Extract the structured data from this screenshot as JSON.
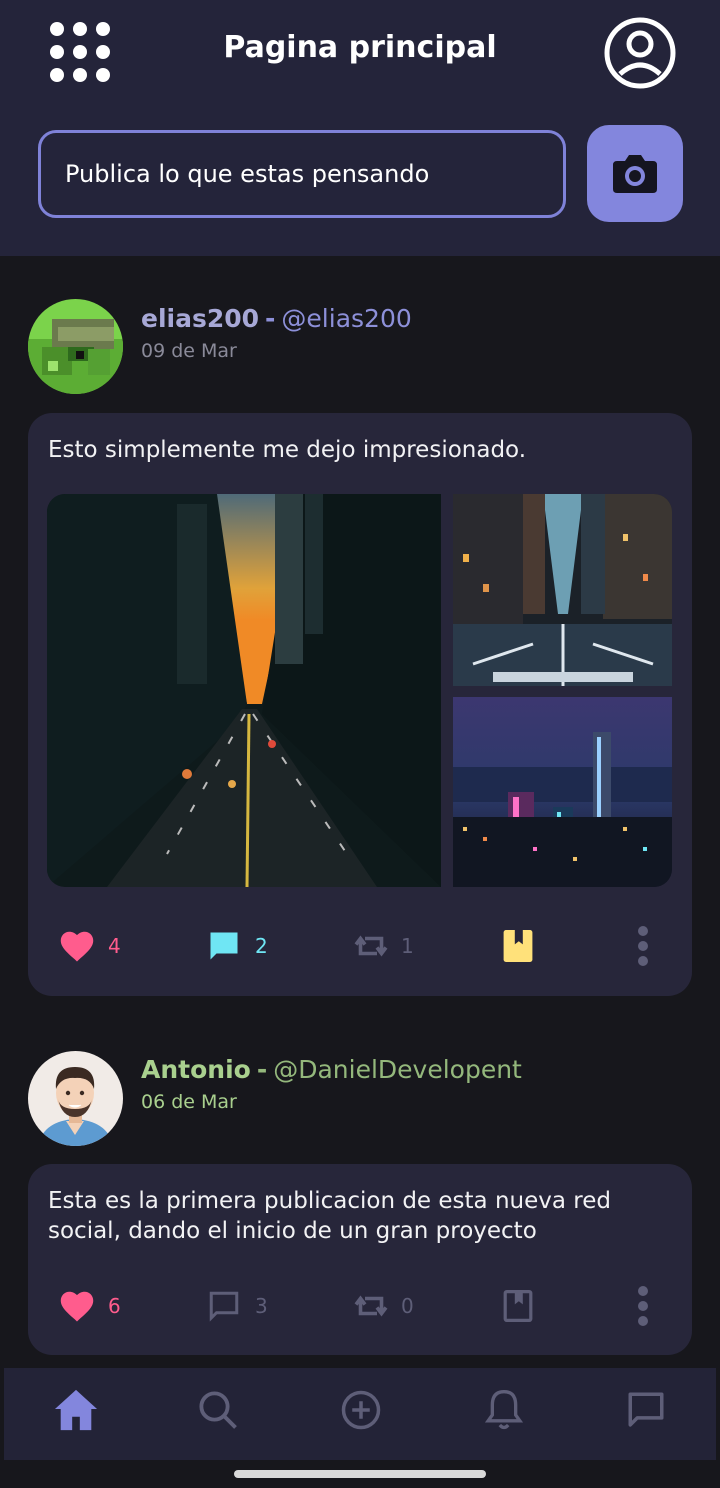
{
  "header": {
    "title": "Pagina principal",
    "composer_placeholder": "Publica lo que estas pensando",
    "menu_icon": "grid-icon",
    "profile_icon": "profile-circle-icon",
    "camera_icon": "camera-icon"
  },
  "posts": [
    {
      "username": "elias200",
      "separator": "-",
      "handle": "@elias200",
      "date": "09 de Mar",
      "text": "Esto simplemente me dejo impresionado.",
      "images": [
        "city-street-sunset",
        "city-road-night",
        "city-skyline-night"
      ],
      "likes": "4",
      "comments": "2",
      "reposts": "1",
      "colors": {
        "name": "#a7a8d6",
        "handle": "#8d90d9",
        "date": "#8a8a99"
      }
    },
    {
      "username": "Antonio",
      "separator": "-",
      "handle": "@DanielDevelopent",
      "date": "06 de Mar",
      "text": "Esta es la primera publicacion de esta nueva red social, dando el inicio de un gran proyecto",
      "likes": "6",
      "comments": "3",
      "reposts": "0",
      "colors": {
        "name": "#a9d08e",
        "handle": "#94b87c",
        "date": "#a9d08e"
      }
    }
  ],
  "colors": {
    "like": "#ff5c8d",
    "comment_active": "#6fe6f4",
    "bookmark_active": "#ffe17a",
    "muted": "#5e5e78",
    "accent": "#8386dd"
  },
  "nav": [
    "home-icon",
    "search-icon",
    "add-icon",
    "bell-icon",
    "chat-icon"
  ]
}
